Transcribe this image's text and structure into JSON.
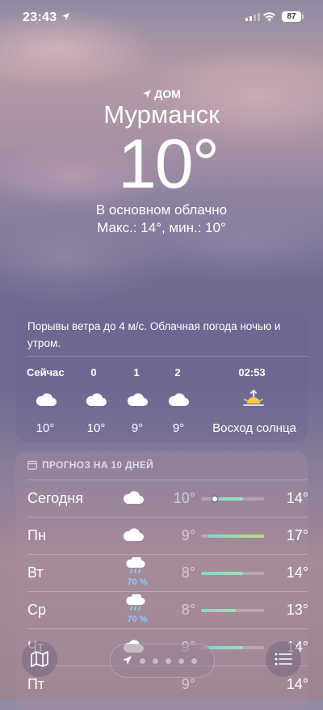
{
  "status_bar": {
    "time": "23:43",
    "battery": "87"
  },
  "location": {
    "home_label": "ДОМ",
    "city": "Мурманск",
    "temperature": "10°",
    "condition": "В основном облачно",
    "hi_lo": "Макс.: 14°, мин.: 10°"
  },
  "hourly": {
    "summary": "Порывы ветра до 4 м/с. Облачная погода ночью и утром.",
    "items": [
      {
        "label": "Сейчас",
        "icon": "cloud-icon",
        "temp": "10°"
      },
      {
        "label": "0",
        "icon": "cloud-icon",
        "temp": "10°"
      },
      {
        "label": "1",
        "icon": "cloud-icon",
        "temp": "9°"
      },
      {
        "label": "2",
        "icon": "cloud-icon",
        "temp": "9°"
      },
      {
        "label": "02:53",
        "icon": "sunrise-icon",
        "temp": "Восход солнца"
      }
    ]
  },
  "daily": {
    "header": "ПРОГНОЗ НА 10 ДНЕЙ",
    "scale_min": 8,
    "scale_max": 17,
    "days": [
      {
        "day": "Сегодня",
        "icon": "cloud-icon",
        "precip": "",
        "lo": "10°",
        "hi": "14°",
        "lo_value": 10,
        "hi_value": 14,
        "current_value": 10
      },
      {
        "day": "Пн",
        "icon": "cloud-icon",
        "precip": "",
        "lo": "9°",
        "hi": "17°",
        "lo_value": 9,
        "hi_value": 17
      },
      {
        "day": "Вт",
        "icon": "rain-cloud-icon",
        "precip": "70 %",
        "lo": "8°",
        "hi": "14°",
        "lo_value": 8,
        "hi_value": 14
      },
      {
        "day": "Ср",
        "icon": "rain-cloud-icon",
        "precip": "70 %",
        "lo": "8°",
        "hi": "13°",
        "lo_value": 8,
        "hi_value": 13
      },
      {
        "day": "Чт",
        "icon": "cloud-icon",
        "precip": "",
        "lo": "9°",
        "hi": "14°",
        "lo_value": 9,
        "hi_value": 14
      },
      {
        "day": "Пт",
        "icon": "cloud-icon",
        "precip": "",
        "lo": "9°",
        "hi": "14°",
        "lo_value": 9,
        "hi_value": 14
      }
    ]
  },
  "colors": {
    "cool": "#7fd9d4",
    "warm": "#c8dc7a",
    "accent": "#9fe0b8"
  }
}
